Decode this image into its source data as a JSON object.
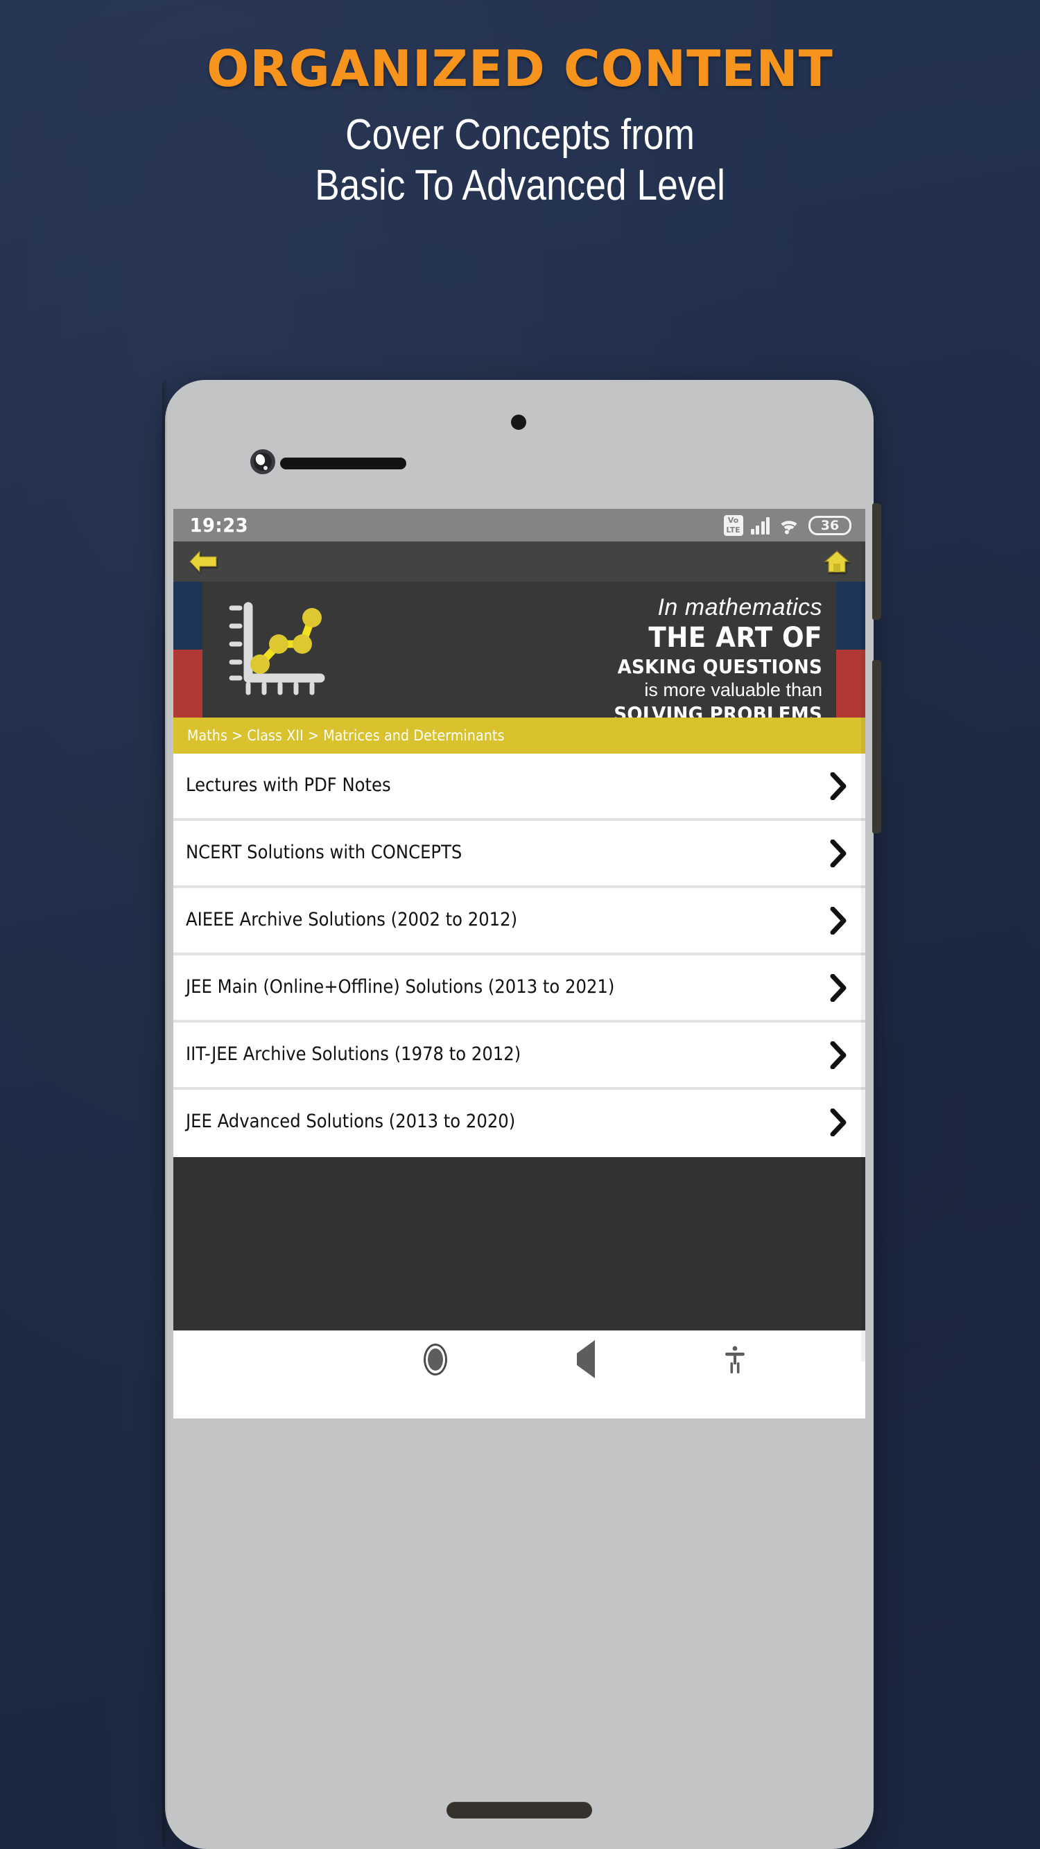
{
  "promo": {
    "headline": "ORGANIZED CONTENT",
    "subline_1": "Cover Concepts from",
    "subline_2": "Basic To Advanced Level",
    "headline_color": "#f7941e",
    "subline_color": "#ffffff",
    "background_color": "#22304d"
  },
  "phone": {
    "status_bar": {
      "time": "19:23",
      "volte_top": "Vo",
      "volte_bottom": "LTE",
      "battery_level": "36",
      "icons": [
        "volte-icon",
        "cellular-signal-icon",
        "wifi-icon",
        "battery-icon"
      ],
      "background_color": "#848484"
    },
    "app_bar": {
      "back_icon": "back-arrow-icon",
      "home_icon": "home-icon",
      "icon_color": "#e8d43a",
      "background_color": "#434343"
    },
    "banner": {
      "line_1": "In mathematics",
      "line_2": "THE ART OF",
      "line_3": "ASKING QUESTIONS",
      "line_4": "is more valuable than",
      "line_5": "SOLVING PROBLEMS",
      "icon": "line-chart-icon",
      "background_color": "#383838",
      "accent_blue": "#1d3557",
      "accent_red": "#b03a33"
    },
    "breadcrumb": {
      "text": "Maths > Class XII > Matrices and Determinants",
      "background_color": "#d9c22e",
      "text_color": "#ffffff"
    },
    "list_items": [
      {
        "label": "Lectures with PDF Notes",
        "chevron": "chevron-right-icon"
      },
      {
        "label": "NCERT Solutions with CONCEPTS",
        "chevron": "chevron-right-icon"
      },
      {
        "label": "AIEEE Archive Solutions (2002 to 2012)",
        "chevron": "chevron-right-icon"
      },
      {
        "label": "JEE Main (Online+Offline) Solutions (2013 to 2021)",
        "chevron": "chevron-right-icon"
      },
      {
        "label": "IIT-JEE Archive Solutions (1978 to 2012)",
        "chevron": "chevron-right-icon"
      },
      {
        "label": "JEE Advanced Solutions (2013 to 2020)",
        "chevron": "chevron-right-icon"
      }
    ],
    "nav_bar": {
      "items": [
        "recent-apps-icon",
        "home-circle-icon",
        "back-triangle-icon",
        "accessibility-icon"
      ],
      "background_color": "#ffffff"
    }
  }
}
